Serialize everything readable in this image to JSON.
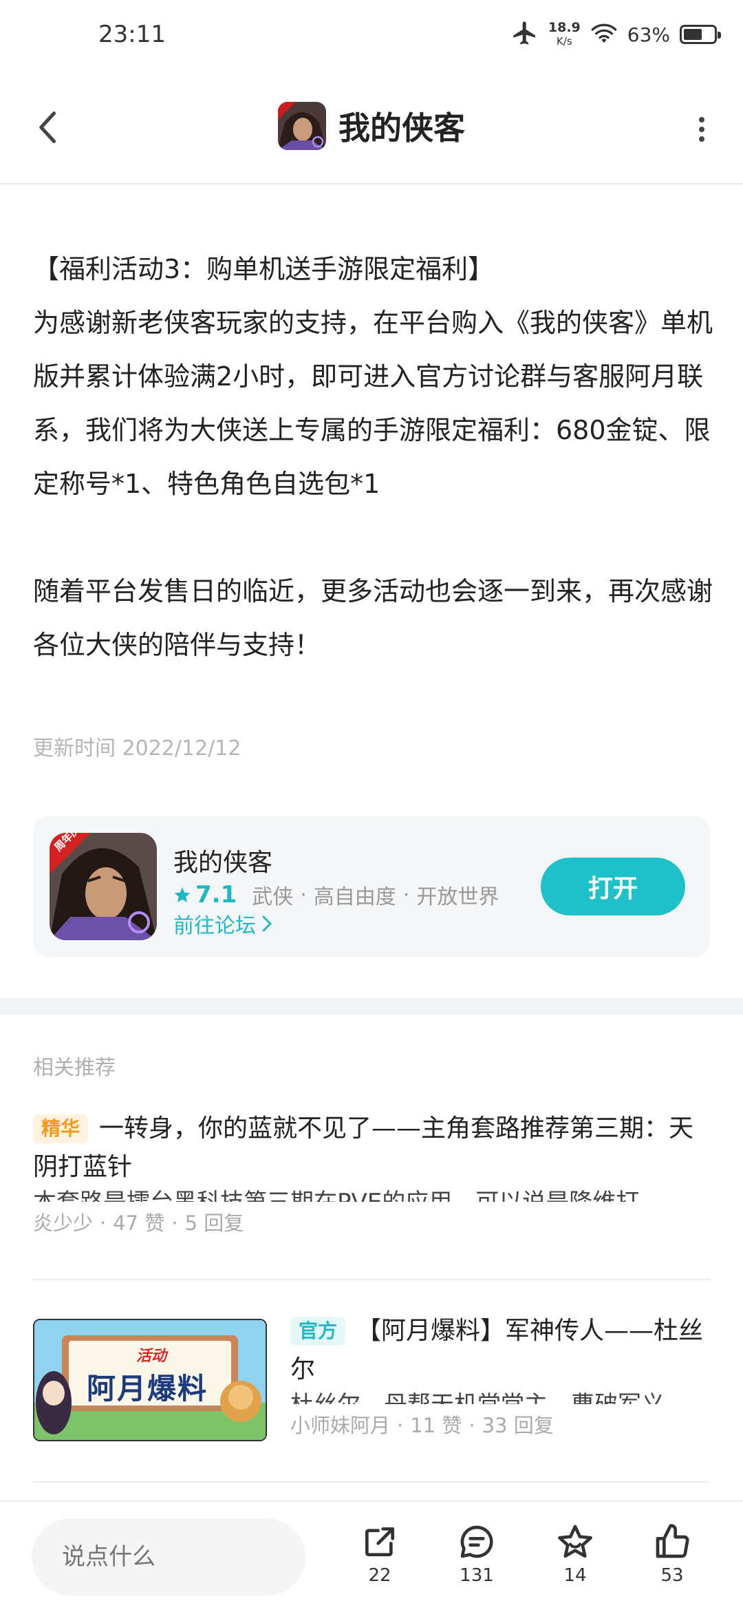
{
  "status_bar": {
    "time": "23:11",
    "speed_value": "18.9",
    "speed_unit": "K/s",
    "battery_percent": "63%",
    "battery_level": 0.63,
    "icons": [
      "airplane-icon",
      "wifi-icon",
      "battery-icon"
    ]
  },
  "header": {
    "title": "我的侠客",
    "back_icon": "chevron-left-icon",
    "more_icon": "more-vertical-icon"
  },
  "article": {
    "paragraphs": [
      "【福利活动3：购单机送手游限定福利】",
      "为感谢新老侠客玩家的支持，在平台购入《我的侠客》单机版并累计体验满2小时，即可进入官方讨论群与客服阿月联系，我们将为大侠送上专属的手游限定福利：680金锭、限定称号*1、特色角色自选包*1",
      "随着平台发售日的临近，更多活动也会逐一到来，再次感谢各位大侠的陪伴与支持！"
    ],
    "update_time": "更新时间 2022/12/12"
  },
  "app_card": {
    "name": "我的侠客",
    "rating": "7.1",
    "tags": [
      "武侠",
      "高自由度",
      "开放世界"
    ],
    "forum_link": "前往论坛",
    "open_button": "打开",
    "icon_badge": "周年庆"
  },
  "related": {
    "section_title": "相关推荐",
    "posts": [
      {
        "badge": "精华",
        "title": "一转身，你的蓝就不见了——主角套路推荐第三期：天阴打蓝针",
        "snippet": "本套路是擂台黑科技第三期在PVE的应用，可以说是降维打",
        "author": "炎少少",
        "likes": "47 赞",
        "replies": "5 回复"
      },
      {
        "badge": "官方",
        "title": "【阿月爆料】军神传人——杜丝尔",
        "snippet": "杜丝尔，丹帮天机堂堂主，曹破军义",
        "author": "小师妹阿月",
        "likes": "11 赞",
        "replies": "33 回复",
        "thumb_small": "活动",
        "thumb_big": "阿月爆料"
      }
    ]
  },
  "bottom_bar": {
    "input_placeholder": "说点什么",
    "share_count": "22",
    "comment_count": "131",
    "favorite_count": "14",
    "like_count": "53"
  },
  "colors": {
    "accent": "#1fc0c8",
    "featured_badge": "#f39a1b",
    "meta_text": "#aaaaaa"
  }
}
